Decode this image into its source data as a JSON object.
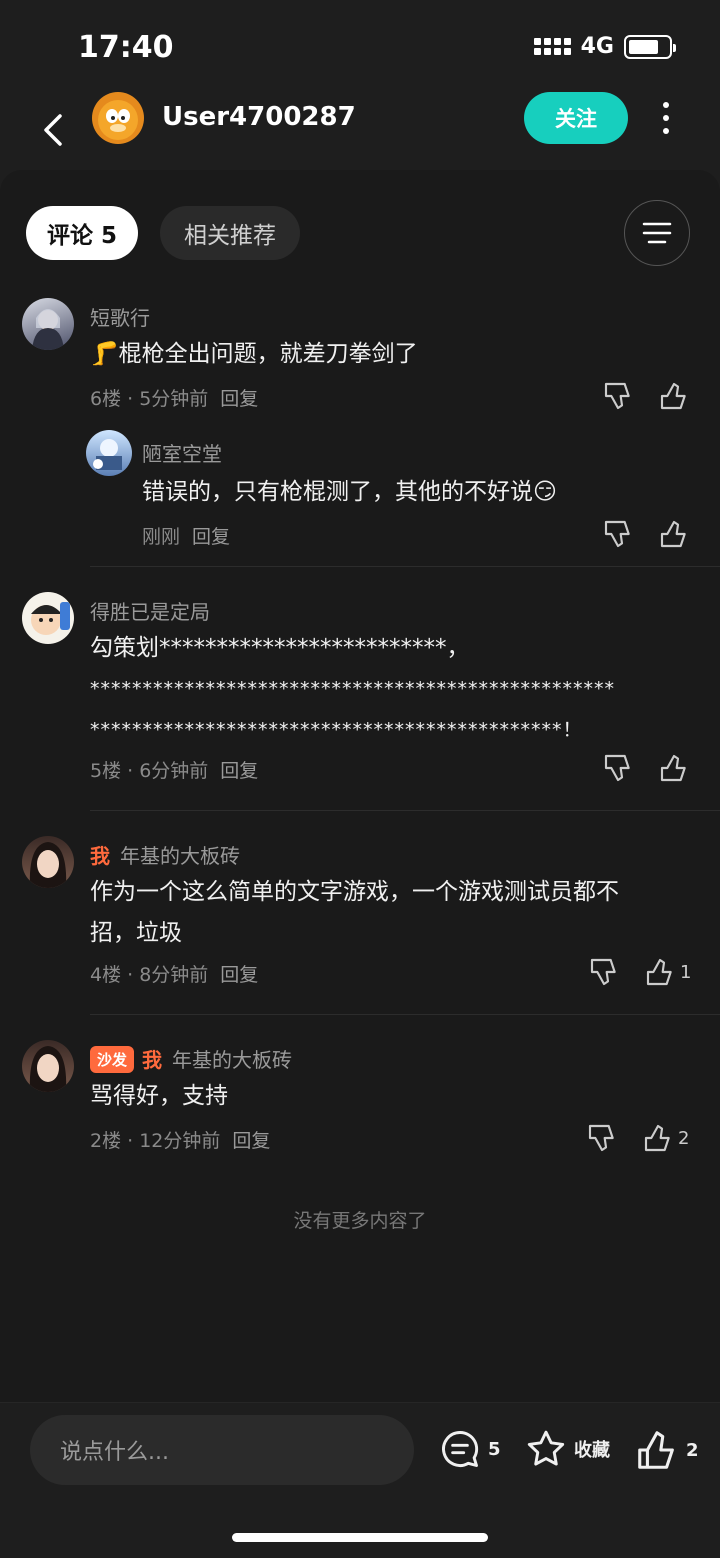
{
  "status": {
    "time": "17:40",
    "network": "4G"
  },
  "header": {
    "username": "User4700287",
    "follow_label": "关注"
  },
  "tabs": {
    "comments_label": "评论 5",
    "related_label": "相关推荐"
  },
  "comments": [
    {
      "name": "短歌行",
      "text": "🦵棍枪全出问题，就差刀拳剑了",
      "meta": "6楼 · 5分钟前",
      "reply_label": "回复",
      "replies": [
        {
          "name": "陋室空堂",
          "text": "错误的，只有枪棍测了，其他的不好说😏",
          "meta": "刚刚",
          "reply_label": "回复"
        }
      ]
    },
    {
      "name": "得胜已是定局",
      "text_lines": [
        "勾策划*************************，",
        "**************************************************",
        "*********************************************！"
      ],
      "meta": "5楼 · 6分钟前",
      "reply_label": "回复"
    },
    {
      "me_tag": "我",
      "name": "年基的大板砖",
      "text_lines": [
        "作为一个这么简单的文字游戏，一个游戏测试员都不",
        "招，垃圾"
      ],
      "meta": "4楼 · 8分钟前",
      "reply_label": "回复",
      "likes": "1"
    },
    {
      "sofa_tag": "沙发",
      "me_tag": "我",
      "name": "年基的大板砖",
      "text": "骂得好，支持",
      "meta": "2楼 · 12分钟前",
      "reply_label": "回复",
      "likes": "2"
    }
  ],
  "footer_note": "没有更多内容了",
  "bottom": {
    "input_placeholder": "说点什么...",
    "comment_count": "5",
    "collect_label": "收藏",
    "like_count": "2"
  },
  "colors": {
    "accent": "#17cfbe",
    "me_tag": "#ff6a3d",
    "background": "#1a1a1a"
  },
  "icons": [
    "back-arrow-icon",
    "more-dots-icon",
    "sort-icon",
    "dislike-icon",
    "like-icon",
    "comment-icon",
    "star-icon"
  ]
}
